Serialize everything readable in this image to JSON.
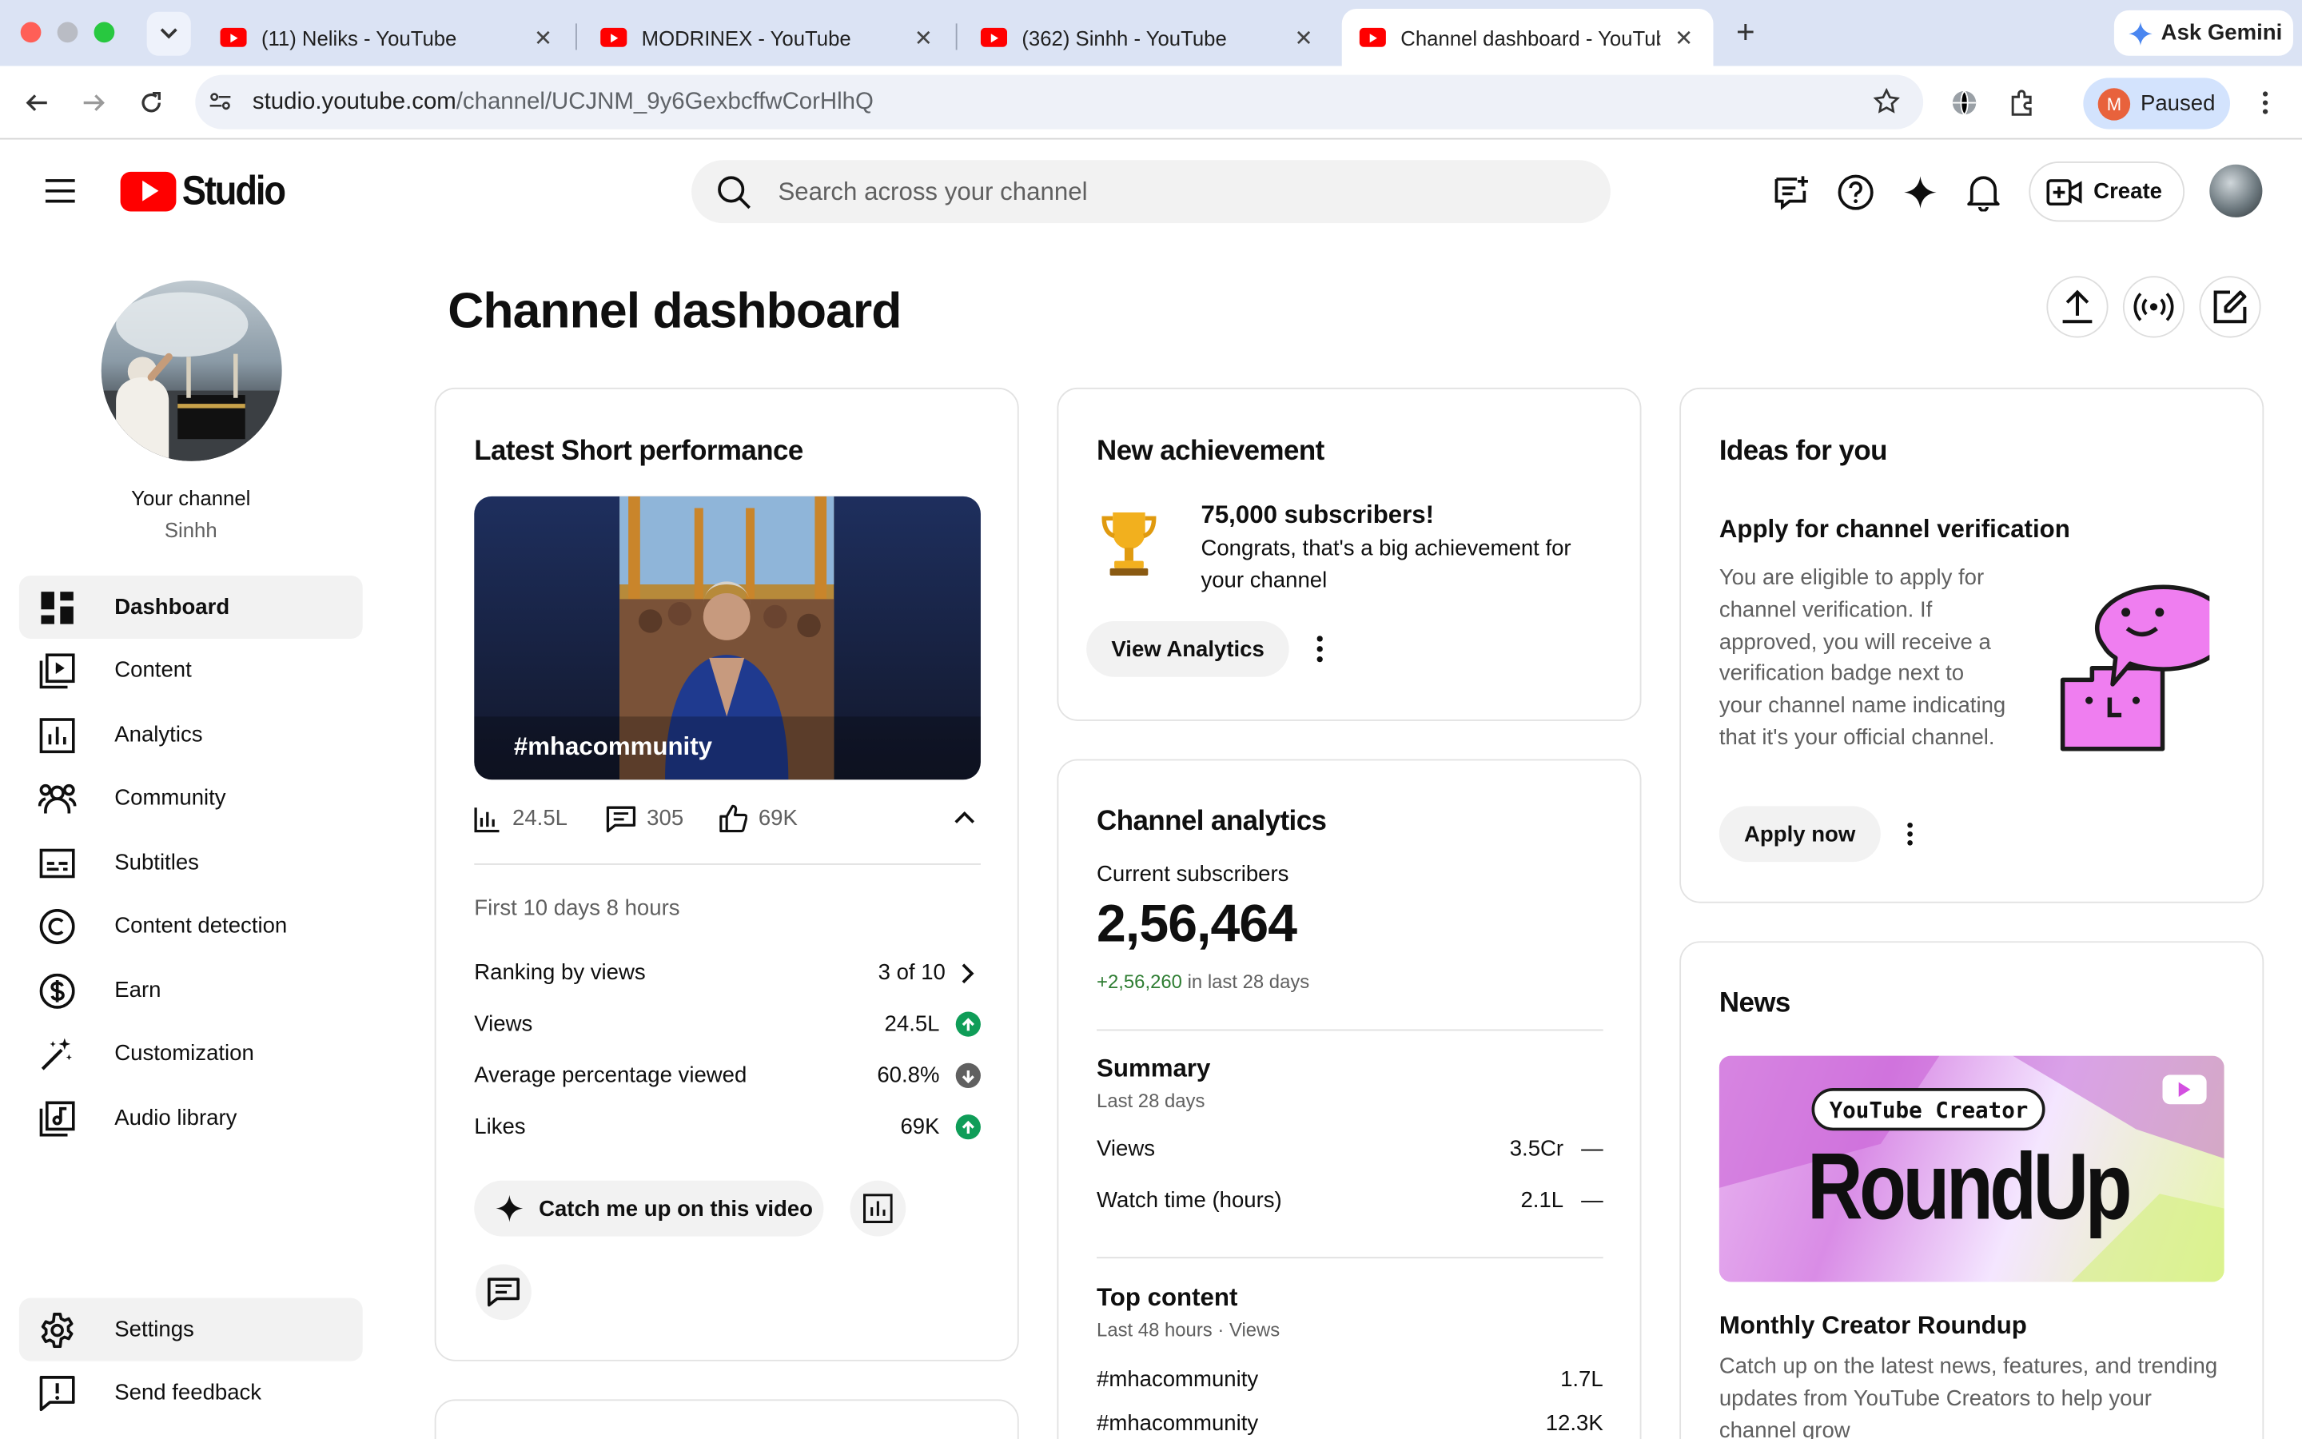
{
  "browser": {
    "tabs": [
      {
        "title": "(11) Neliks - YouTube"
      },
      {
        "title": "MODRINEX - YouTube"
      },
      {
        "title": "(362) Sinhh - YouTube"
      },
      {
        "title": "Channel dashboard - YouTube"
      }
    ],
    "gemini_label": "Ask Gemini",
    "url_host": "studio.youtube.com",
    "url_path": "/channel/UCJNM_9y6GexbcffwCorHlhQ",
    "profile_initial": "M",
    "profile_status": "Paused"
  },
  "header": {
    "logo_text": "Studio",
    "search_placeholder": "Search across your channel",
    "create_label": "Create"
  },
  "sidebar": {
    "channel_label": "Your channel",
    "channel_name": "Sinhh",
    "items": [
      {
        "label": "Dashboard",
        "icon": "dashboard-icon",
        "active": true
      },
      {
        "label": "Content",
        "icon": "content-icon"
      },
      {
        "label": "Analytics",
        "icon": "analytics-icon"
      },
      {
        "label": "Community",
        "icon": "community-icon"
      },
      {
        "label": "Subtitles",
        "icon": "subtitles-icon"
      },
      {
        "label": "Content detection",
        "icon": "copyright-icon"
      },
      {
        "label": "Earn",
        "icon": "dollar-icon"
      },
      {
        "label": "Customization",
        "icon": "magic-wand-icon"
      },
      {
        "label": "Audio library",
        "icon": "audio-library-icon"
      }
    ],
    "settings_label": "Settings",
    "feedback_label": "Send feedback"
  },
  "page": {
    "title": "Channel dashboard"
  },
  "latest_short": {
    "title": "Latest Short performance",
    "thumbnail_caption": "#mhacommunity",
    "views": "24.5L",
    "comments": "305",
    "likes": "69K",
    "period": "First 10 days 8 hours",
    "ranking_label": "Ranking by views",
    "ranking_value": "3 of 10",
    "metrics": [
      {
        "label": "Views",
        "value": "24.5L",
        "trend": "up"
      },
      {
        "label": "Average percentage viewed",
        "value": "60.8%",
        "trend": "down"
      },
      {
        "label": "Likes",
        "value": "69K",
        "trend": "up"
      }
    ],
    "catch_up_label": "Catch me up on this video"
  },
  "achievement": {
    "title": "New achievement",
    "headline": "75,000 subscribers!",
    "body": "Congrats, that's a big achievement for your channel",
    "button": "View Analytics"
  },
  "analytics": {
    "title": "Channel analytics",
    "subs_label": "Current subscribers",
    "subs_value": "2,56,464",
    "subs_change": "+2,56,260",
    "subs_change_suffix": "in last 28 days",
    "summary_title": "Summary",
    "summary_period": "Last 28 days",
    "summary_rows": [
      {
        "label": "Views",
        "value": "3.5Cr"
      },
      {
        "label": "Watch time (hours)",
        "value": "2.1L"
      }
    ],
    "top_title": "Top content",
    "top_period": "Last 48 hours · Views",
    "top_rows": [
      {
        "label": "#mhacommunity",
        "value": "1.7L"
      },
      {
        "label": "#mhacommunity",
        "value": "12.3K"
      }
    ]
  },
  "ideas": {
    "title": "Ideas for you",
    "subtitle": "Apply for channel verification",
    "body": "You are eligible to apply for channel verification. If approved, you will receive a verification badge next to your channel name indicating that it's your official channel.",
    "button": "Apply now"
  },
  "news": {
    "title": "News",
    "banner_pill": "YouTube Creator",
    "banner_big": "RoundUp",
    "item_title": "Monthly Creator Roundup",
    "item_body": "Catch up on the latest news, features, and trending updates from YouTube Creators to help your channel grow"
  },
  "colors": {
    "brand_red": "#ff0000",
    "positive_green": "#2e7d32",
    "up_badge": "#0f9d58"
  }
}
